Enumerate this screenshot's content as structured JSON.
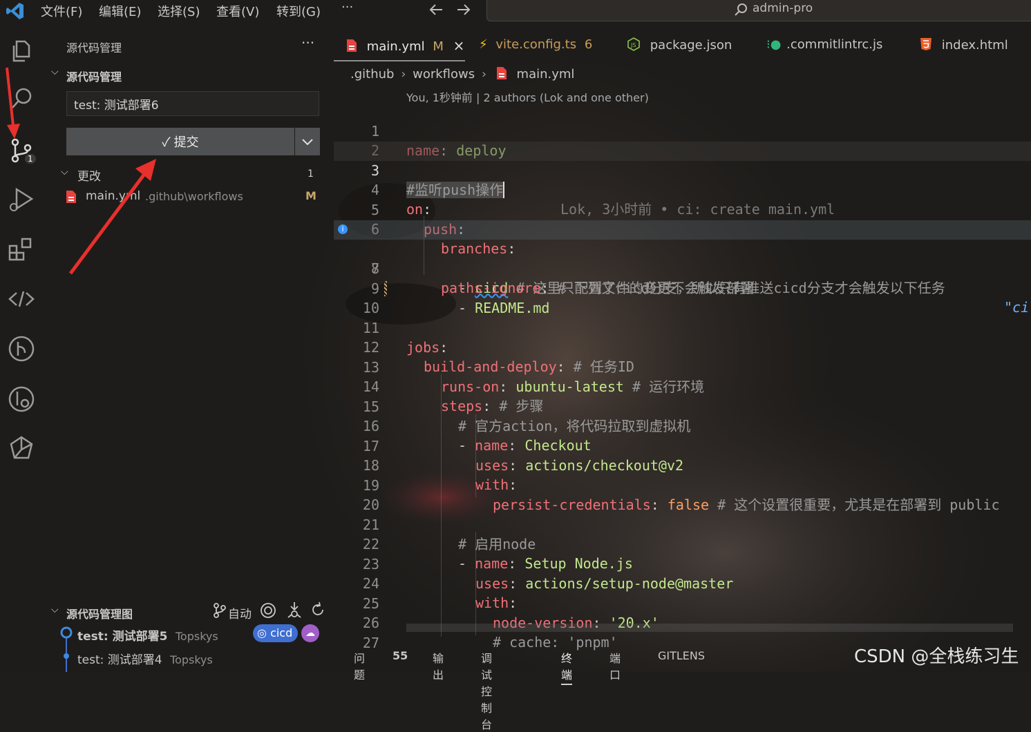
{
  "menu": [
    "文件(F)",
    "编辑(E)",
    "选择(S)",
    "查看(V)",
    "转到(G)",
    "···"
  ],
  "command_center": "admin-pro",
  "activity_badge": "1",
  "sidebar": {
    "title": "源代码管理",
    "more": "···",
    "section": "源代码管理",
    "commit_message": "test: 测试部署6",
    "commit_button": "✓ 提交",
    "changes_label": "更改",
    "changes_count": "1",
    "file_name": "main.yml",
    "file_path": ".github\\workflows",
    "file_status": "M",
    "graph_section": "源代码管理图",
    "graph_auto": "自动",
    "graph_items": [
      {
        "message": "test: 测试部署5",
        "author": "Topskys",
        "branch": "cicd"
      },
      {
        "message": "test: 测试部署4",
        "author": "Topskys"
      }
    ]
  },
  "tabs": [
    {
      "label": "main.yml",
      "modified": "M",
      "close": "×"
    },
    {
      "label": "vite.config.ts",
      "badge": "6"
    },
    {
      "label": "package.json"
    },
    {
      "label": ".commitlintrc.js"
    },
    {
      "label": "index.html"
    }
  ],
  "breadcrumb": [
    ".github",
    "workflows",
    "main.yml"
  ],
  "blame_header": "You, 1秒钟前 | 2 authors (Lok and one other)",
  "inline_blame": "Lok, 3小时前 • ci: create main.yml",
  "code": {
    "l1_key": "name",
    "l1_val": "deploy",
    "l3": "#监听push操作",
    "l4": "on",
    "l5": "push",
    "l6": "branches",
    "l7_val": "cicd",
    "l7_comment": "# 这里只配置了cicd分支，所以只有推送cicd分支才会触发以下任务",
    "l7_extra": "\"ci",
    "l8_key": "paths-ignore",
    "l8_comment": "# 下列文件的变更不会触发部署",
    "l9_val": "README.md",
    "l11": "jobs",
    "l12_key": "build-and-deploy",
    "l12_comment": "# 任务ID",
    "l13_key": "runs-on",
    "l13_val": "ubuntu-latest",
    "l13_comment": "# 运行环境",
    "l14_key": "steps",
    "l14_comment": "# 步骤",
    "l15": "# 官方action，将代码拉取到虚拟机",
    "l16_key": "name",
    "l16_val": "Checkout",
    "l17_key": "uses",
    "l17_val": "actions/checkout@v2",
    "l18_key": "with",
    "l19_key": "persist-credentials",
    "l19_val": "false",
    "l19_comment": "# 这个设置很重要，尤其是在部署到 public",
    "l21": "# 启用node",
    "l22_key": "name",
    "l22_val": "Setup Node.js",
    "l23_key": "uses",
    "l23_val": "actions/setup-node@master",
    "l24_key": "with",
    "l25_key": "node-version",
    "l25_val": "'20.x'",
    "l26": "# cache: 'pnpm'"
  },
  "line_numbers": [
    "1",
    "2",
    "3",
    "4",
    "5",
    "6",
    "7",
    "8",
    "9",
    "10",
    "11",
    "12",
    "13",
    "14",
    "15",
    "16",
    "17",
    "18",
    "19",
    "20",
    "21",
    "22",
    "23",
    "24",
    "25",
    "26",
    "27"
  ],
  "panel_tabs": [
    "问题",
    "55",
    "输出",
    "调试控制台",
    "终端",
    "端口",
    "GITLENS"
  ],
  "watermark": "CSDN @全栈练习生",
  "colors": {
    "accent_red": "#e8302c",
    "badge_blue": "#3f6fd1",
    "yaml_key": "#f07178",
    "yaml_value": "#c3e88d"
  }
}
